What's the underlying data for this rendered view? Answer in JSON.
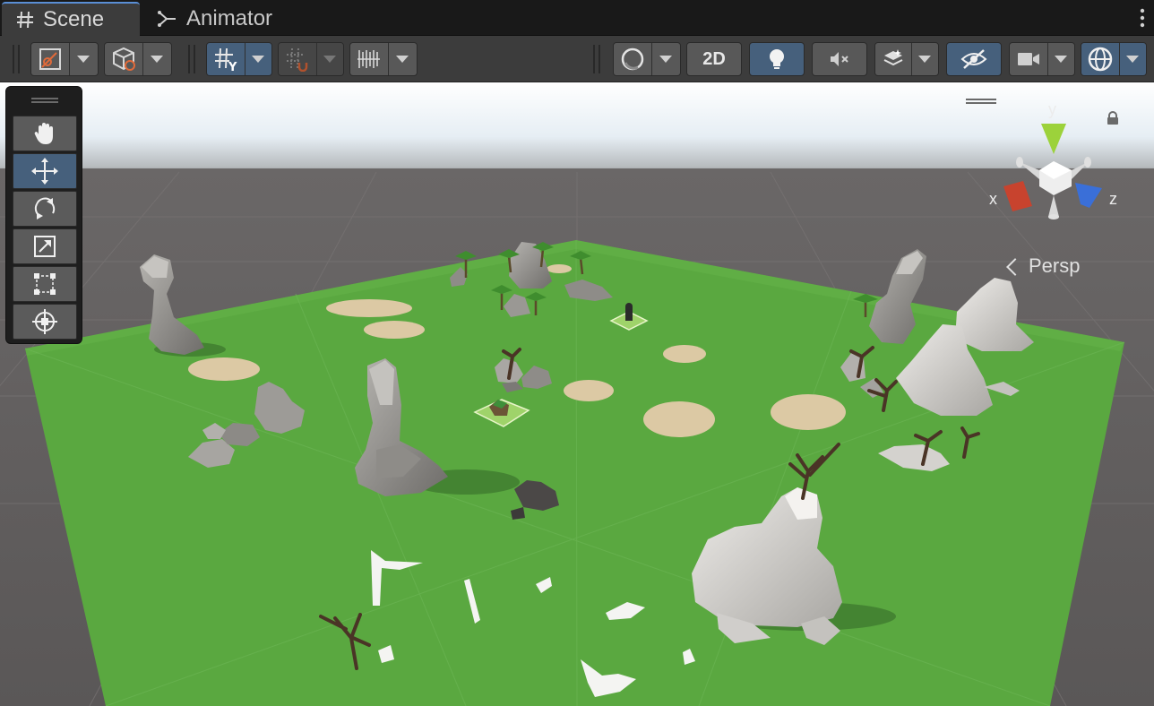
{
  "tabs": {
    "scene": {
      "label": "Scene",
      "icon": "hash-icon"
    },
    "animator": {
      "label": "Animator",
      "icon": "animator-icon"
    }
  },
  "toolbar": {
    "left_groups": [
      {
        "name": "draw-mode-dropdown",
        "icon": "draw-mode-icon"
      },
      {
        "name": "render-mode-dropdown",
        "icon": "cube-icon"
      },
      {
        "name": "grid-snap-dropdown",
        "icon": "grid-y-icon",
        "active": true
      },
      {
        "name": "increment-snap-dropdown",
        "icon": "snap-magnet-icon",
        "active": false
      },
      {
        "name": "grid-visibility-dropdown",
        "icon": "ruler-grid-icon"
      }
    ],
    "right_groups": [
      {
        "name": "shading-dropdown",
        "icon": "sphere-icon"
      },
      {
        "name": "2d-toggle",
        "label": "2D"
      },
      {
        "name": "lighting-toggle",
        "icon": "lightbulb-icon",
        "active": true
      },
      {
        "name": "audio-toggle",
        "icon": "audio-mute-icon"
      },
      {
        "name": "effects-dropdown",
        "icon": "layers-icon"
      },
      {
        "name": "hidden-objects-toggle",
        "icon": "eye-slash-icon",
        "active": true
      },
      {
        "name": "camera-dropdown",
        "icon": "camera-icon"
      },
      {
        "name": "gizmos-dropdown",
        "icon": "gizmo-globe-icon",
        "active": true
      }
    ],
    "twod_label": "2D"
  },
  "tools": [
    {
      "name": "hand-tool",
      "icon": "hand-icon",
      "active": false
    },
    {
      "name": "move-tool",
      "icon": "move-arrows-icon",
      "active": true
    },
    {
      "name": "rotate-tool",
      "icon": "rotate-icon",
      "active": false
    },
    {
      "name": "scale-tool",
      "icon": "scale-icon",
      "active": false
    },
    {
      "name": "rect-tool",
      "icon": "rect-transform-icon",
      "active": false
    },
    {
      "name": "transform-tool",
      "icon": "transform-icon",
      "active": false
    }
  ],
  "gizmo": {
    "x_label": "x",
    "y_label": "y",
    "z_label": "z",
    "projection_label": "Persp",
    "colors": {
      "x": "#c8432e",
      "y": "#9cd23b",
      "z": "#3a6fd8"
    }
  },
  "scene": {
    "ground_color": "#5aa840",
    "sky_top": "#ffffff",
    "horizon": "#7a7878",
    "void_color": "#5e5b5b"
  }
}
